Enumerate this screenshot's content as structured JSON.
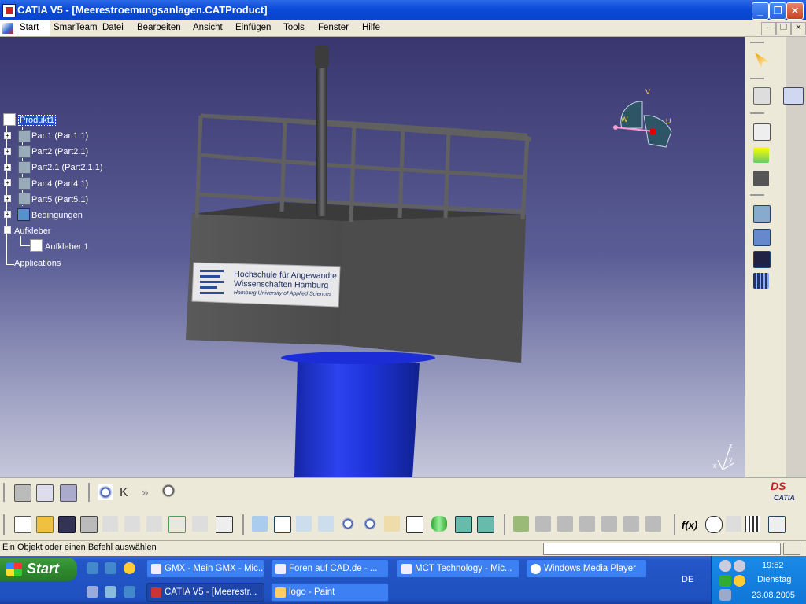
{
  "window": {
    "title": "CATIA V5 - [Meerestroemungsanlagen.CATProduct]",
    "controls": [
      "_",
      "❐",
      "✕"
    ]
  },
  "menu": {
    "items": [
      "Start",
      "SmarTeam",
      "Datei",
      "Bearbeiten",
      "Ansicht",
      "Einfügen",
      "Tools",
      "Fenster",
      "Hilfe"
    ],
    "doc_controls": [
      "–",
      "❐",
      "✕"
    ]
  },
  "tree": {
    "root": "Produkt1",
    "parts": [
      "Part1 (Part1.1)",
      "Part2 (Part2.1)",
      "Part2.1 (Part2.1.1)",
      "Part4 (Part4.1)",
      "Part5 (Part5.1)"
    ],
    "constraints": "Bedingungen",
    "stickers": "Aufkleber",
    "sticker_child": "Aufkleber 1",
    "applications": "Applications"
  },
  "compass": {
    "v": "V",
    "w": "W",
    "u": "U"
  },
  "axis": {
    "z": "z",
    "x": "x",
    "y": "y"
  },
  "model_label": {
    "line1": "Hochschule für Angewandte",
    "line2": "Wissenschaften Hamburg",
    "line3": "Hamburg University of Applied Sciences"
  },
  "logo": {
    "ds": "DS",
    "catia": "CATIA"
  },
  "formula": {
    "fx": "f(x)"
  },
  "status": {
    "prompt": "Ein Objekt oder einen Befehl auswählen",
    "input": ""
  },
  "taskbar": {
    "start_label": "Start",
    "row1": [
      "GMX - Mein GMX - Mic...",
      "Foren auf CAD.de - ...",
      "MCT Technology - Mic...",
      "Windows Media Player"
    ],
    "row2": [
      "CATIA V5 - [Meerestr...",
      "logo - Paint"
    ],
    "language": "DE",
    "clock": {
      "time": "19:52",
      "day": "Dienstag",
      "date": "23.08.2005"
    }
  },
  "colors": {
    "xp_blue": "#0a4ad8",
    "viewport_top": "#39366f",
    "viewport_bottom": "#c6c7da",
    "pillar_blue": "#1e2fd0",
    "platform_grey": "#555555",
    "start_green": "#2f8a2f"
  }
}
